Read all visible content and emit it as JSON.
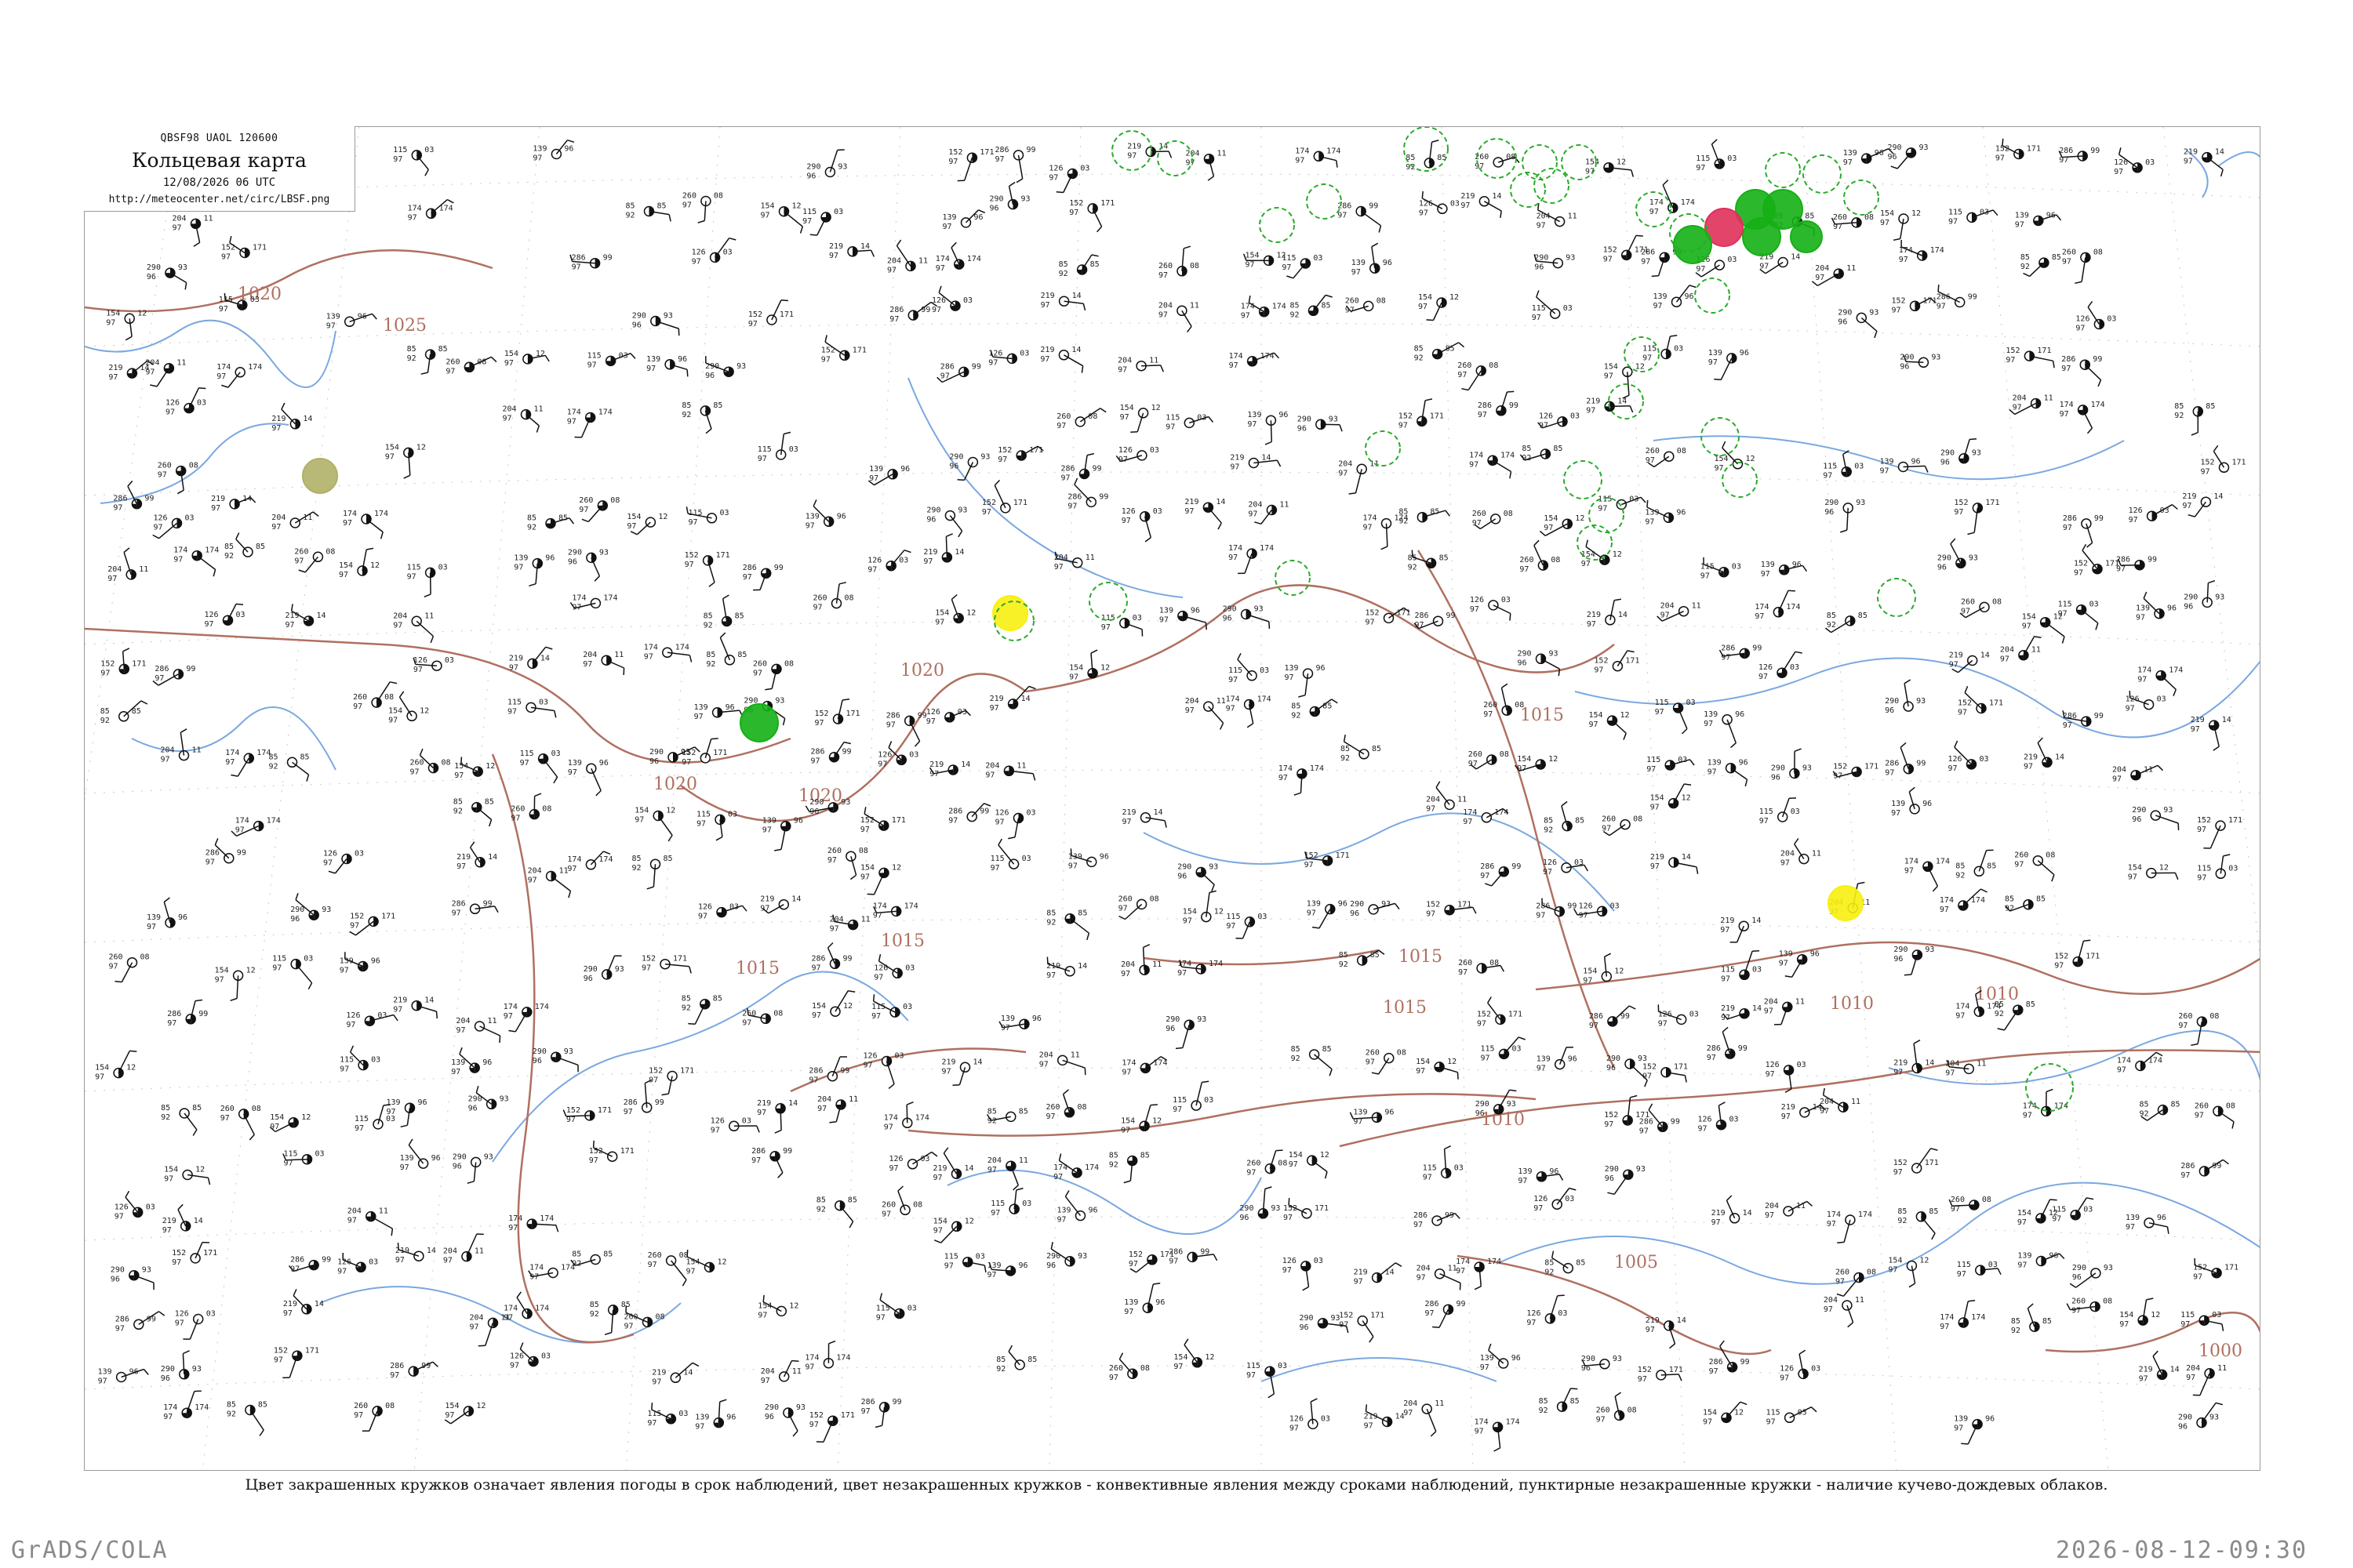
{
  "map": {
    "code_line": "QBSF98  UAOL  120600",
    "title": "Кольцевая карта",
    "datetime": "12/08/2026 06 UTC",
    "url": "http://meteocenter.net/circ/LBSF.png",
    "caption": "Цвет закрашенных кружков означает явления погоды в срок наблюдений, цвет незакрашенных кружков - конвективные явления между сроками наблюдений, пунктирные незакрашенные кружки - наличие кучево-дождевых облаков."
  },
  "isobars": [
    "1025",
    "1020",
    "1020",
    "1020",
    "1020",
    "1015",
    "1015",
    "1015",
    "1015",
    "1015",
    "1010",
    "1010",
    "1010",
    "1005",
    "1000"
  ],
  "colors": {
    "isobar": "#b07060",
    "river": "#7aa8e0",
    "coast": "#7aa8e0",
    "station": "#111111",
    "precip_green": "#15b015",
    "storm_red": "#e0305a",
    "haze_yellow": "#f8f010",
    "mist_olive": "#b0b068",
    "cb_dashed": "#2aaa2a",
    "footer_text": "#8a8a8a"
  },
  "station_samples": [
    {
      "values": [
        "115",
        "97",
        "03"
      ]
    },
    {
      "values": [
        "139",
        "97",
        "96"
      ]
    },
    {
      "values": [
        "290",
        "96",
        "93"
      ]
    },
    {
      "values": [
        "152",
        "97",
        "171"
      ]
    },
    {
      "values": [
        "286",
        "97",
        "99"
      ]
    },
    {
      "values": [
        "126",
        "97",
        "03"
      ]
    },
    {
      "values": [
        "219",
        "97",
        "14"
      ]
    },
    {
      "values": [
        "204",
        "97",
        "11"
      ]
    },
    {
      "values": [
        "174",
        "97",
        "174"
      ]
    },
    {
      "values": [
        "85",
        "92",
        "85"
      ]
    },
    {
      "values": [
        "260",
        "97",
        "08"
      ]
    },
    {
      "values": [
        "154",
        "97",
        "12"
      ]
    }
  ],
  "footer": {
    "left": "GrADS/COLA",
    "right": "2026-08-12-09:30"
  }
}
